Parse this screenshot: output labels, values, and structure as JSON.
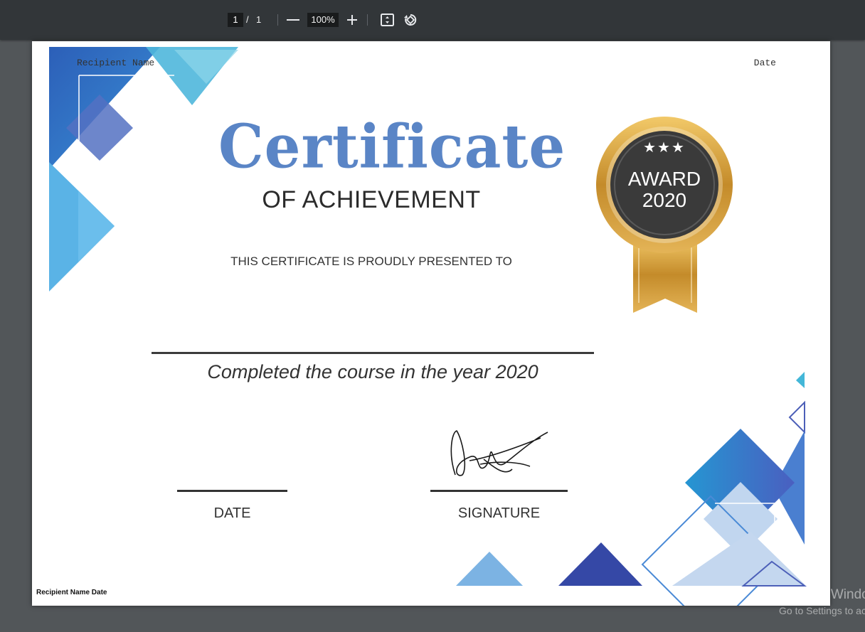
{
  "viewer": {
    "current_page": "1",
    "page_separator": "/",
    "total_pages": "1",
    "zoom": "100%",
    "icons": [
      "zoom-out-icon",
      "zoom-in-icon",
      "fit-page-icon",
      "rotate-icon"
    ]
  },
  "certificate": {
    "recipient_field": "Recipient Name",
    "date_field": "Date",
    "title": "Certificate",
    "subtitle": "OF ACHIEVEMENT",
    "presented_to": "THIS CERTIFICATE IS PROUDLY PRESENTED TO",
    "completion_text": "Completed the course in the year 2020",
    "date_label": "DATE",
    "signature_label": "SIGNATURE",
    "badge_line1": "AWARD",
    "badge_line2": "2020",
    "badge_stars": "★★★",
    "footer": "Recipient Name Date"
  },
  "watermark": {
    "title": "Activate Windows",
    "subtitle": "Go to Settings to activate Windows."
  },
  "colors": {
    "toolbar": "#323639",
    "viewer_bg": "#525659",
    "title_blue": "#5a85c6",
    "gold": "#c9962f",
    "badge_dark": "#3a3a3a"
  }
}
